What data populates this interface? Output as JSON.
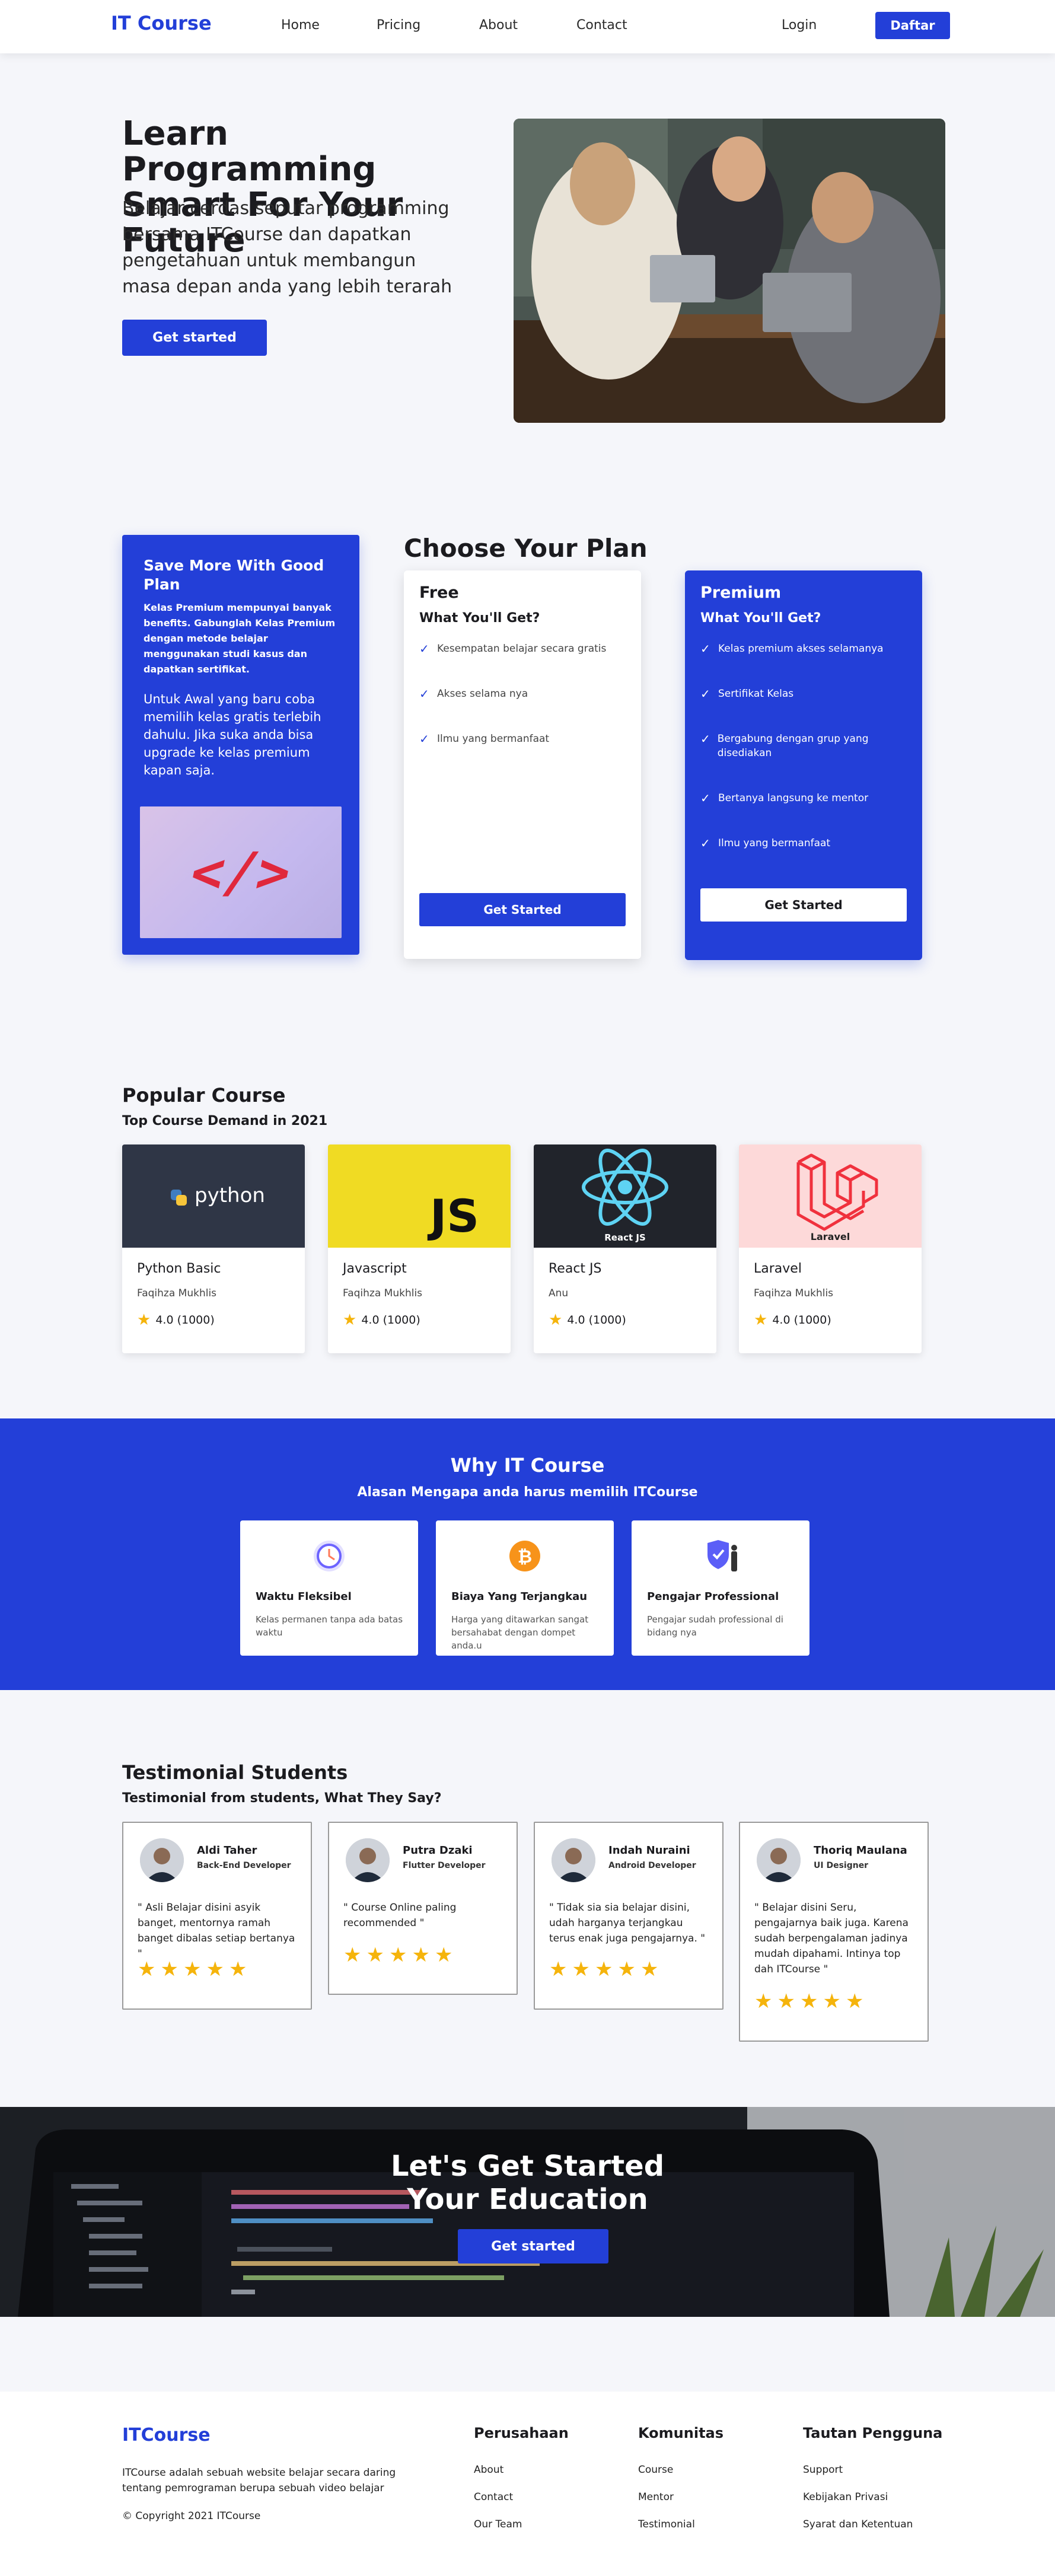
{
  "colors": {
    "primary": "#233fd8",
    "star": "#f5b40c",
    "background": "#f5f6fa"
  },
  "nav": {
    "logo": "IT Course",
    "links": [
      "Home",
      "Pricing",
      "About",
      "Contact"
    ],
    "login": "Login",
    "register": "Daftar"
  },
  "hero": {
    "title": "Learn Programming Smart For Your Future",
    "description": "Belajar cerdas seputar programming bersama ITCourse dan dapatkan pengetahuan untuk membangun masa depan anda yang lebih terarah",
    "cta": "Get started"
  },
  "save": {
    "title": "Save More With Good Plan",
    "p1": "Kelas Premium mempunyai banyak benefits. Gabunglah Kelas Premium dengan metode belajar menggunakan studi kasus dan dapatkan sertifikat.",
    "p2": "Untuk Awal yang baru coba memilih kelas gratis terlebih dahulu. Jika suka anda bisa upgrade ke kelas premium kapan saja.",
    "image_icon": "code-brackets-icon",
    "image_text": "</>"
  },
  "plans": {
    "title": "Choose Your Plan",
    "free": {
      "name": "Free",
      "subtitle": "What You'll Get?",
      "features": [
        "Kesempatan belajar secara gratis",
        "Akses selama nya",
        "Ilmu yang bermanfaat"
      ],
      "cta": "Get Started"
    },
    "premium": {
      "name": "Premium",
      "subtitle": "What You'll Get?",
      "features": [
        "Kelas premium akses selamanya",
        "Sertifikat Kelas",
        "Bergabung dengan grup yang disediakan",
        "Bertanya langsung ke mentor",
        "Ilmu yang bermanfaat"
      ],
      "cta": "Get Started"
    }
  },
  "popular": {
    "title": "Popular Course",
    "subtitle": "Top Course Demand in 2021",
    "courses": [
      {
        "name": "Python Basic",
        "author": "Faqihza Mukhlis",
        "rating": "4.0 (1000)",
        "logo_text": "python",
        "icon": "python-logo-icon"
      },
      {
        "name": "Javascript",
        "author": "Faqihza Mukhlis",
        "rating": "4.0 (1000)",
        "logo_text": "JS",
        "icon": "js-logo-icon"
      },
      {
        "name": "React JS",
        "author": "Anu",
        "rating": "4.0 (1000)",
        "logo_text": "React JS",
        "icon": "react-logo-icon"
      },
      {
        "name": "Laravel",
        "author": "Faqihza Mukhlis",
        "rating": "4.0 (1000)",
        "logo_text": "Laravel",
        "icon": "laravel-logo-icon"
      }
    ]
  },
  "why": {
    "title": "Why IT Course",
    "subtitle": "Alasan Mengapa anda harus memilih ITCourse",
    "cards": [
      {
        "name": "Waktu Fleksibel",
        "desc": "Kelas permanen tanpa ada batas waktu",
        "icon": "clock-icon"
      },
      {
        "name": "Biaya Yang Terjangkau",
        "desc": "Harga yang ditawarkan sangat bersahabat dengan dompet anda.u",
        "icon": "bitcoin-coin-icon"
      },
      {
        "name": "Pengajar Professional",
        "desc": "Pengajar sudah professional di bidang nya",
        "icon": "shield-teacher-icon"
      }
    ]
  },
  "testimonials": {
    "title": "Testimonial Students",
    "subtitle": "Testimonial from students, What They Say?",
    "items": [
      {
        "name": "Aldi Taher",
        "role": "Back-End Developer",
        "quote": "\" Asli Belajar disini asyik banget, mentornya ramah banget dibalas setiap bertanya \"",
        "stars": 5
      },
      {
        "name": "Putra Dzaki",
        "role": "Flutter Developer",
        "quote": "\" Course Online paling recommended \"",
        "stars": 5
      },
      {
        "name": "Indah Nuraini",
        "role": "Android Developer",
        "quote": "\" Tidak sia sia belajar disini, udah harganya terjangkau terus enak juga pengajarnya. \"",
        "stars": 5
      },
      {
        "name": "Thoriq Maulana",
        "role": "UI Designer",
        "quote": "\" Belajar disini Seru, pengajarnya baik juga. Karena sudah berpengalaman jadinya mudah dipahami. Intinya top dah ITCourse \"",
        "stars": 5
      }
    ]
  },
  "cta": {
    "title_line1": "Let's Get Started",
    "title_line2": "Your Education",
    "button": "Get started"
  },
  "footer": {
    "logo": "ITCourse",
    "description": "ITCourse adalah sebuah website belajar secara daring tentang pemrograman berupa sebuah video belajar",
    "copyright": "© Copyright 2021 ITCourse",
    "columns": [
      {
        "title": "Perusahaan",
        "links": [
          "About",
          "Contact",
          "Our Team"
        ]
      },
      {
        "title": "Komunitas",
        "links": [
          "Course",
          "Mentor",
          "Testimonial"
        ]
      },
      {
        "title": "Tautan Pengguna",
        "links": [
          "Support",
          "Kebijakan Privasi",
          "Syarat dan Ketentuan"
        ]
      }
    ]
  }
}
